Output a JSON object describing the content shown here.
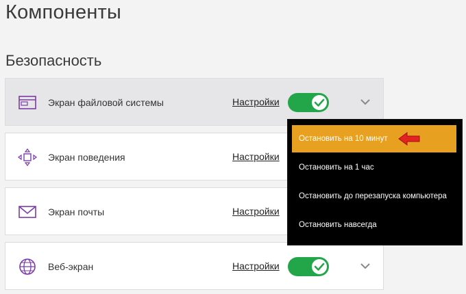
{
  "page_title": "Компоненты",
  "section_title": "Безопасность",
  "components": [
    {
      "name": "Экран файловой системы",
      "settings": "Настройки",
      "enabled": true,
      "icon": "file-system-icon"
    },
    {
      "name": "Экран поведения",
      "settings": "Настройки",
      "icon": "behavior-icon"
    },
    {
      "name": "Экран почты",
      "settings": "Настройки",
      "icon": "mail-icon"
    },
    {
      "name": "Веб-экран",
      "settings": "Настройки",
      "enabled": true,
      "icon": "globe-icon"
    }
  ],
  "stop_menu": {
    "items": [
      "Остановить на 10 минут",
      "Остановить на 1 час",
      "Остановить до перезапуска компьютера",
      "Остановить навсегда"
    ],
    "highlighted_index": 0
  },
  "colors": {
    "toggle_on": "#23a54a",
    "icon_purple": "#7a3ba6",
    "menu_highlight": "#e8a020",
    "annotation_arrow": "#e32322"
  }
}
